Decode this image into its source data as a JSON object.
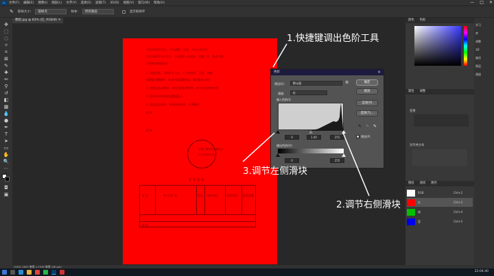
{
  "menubar": {
    "logo": "Ps",
    "items": [
      "文件(F)",
      "编辑(E)",
      "图像(I)",
      "图层(L)",
      "文字(Y)",
      "选择(S)",
      "滤镜(T)",
      "3D(D)",
      "视图(V)",
      "窗口(W)",
      "帮助(H)"
    ],
    "win_controls": [
      "—",
      "□",
      "✕"
    ]
  },
  "options": {
    "sample_label": "取样大小:",
    "sample_value": "取样点",
    "sample2_label": "样本:",
    "sample2_value": "所有图层",
    "ring_label": "显示取样环"
  },
  "document_tab": "教程.jpg @ 83% (红, RGB/8) ✕",
  "document": {
    "lines": [
      "2021年8月18日，六年级第一次会，于长沙市召开",
      "2021年8月18-20日，六年级第一次会议，会期三天，到会代表",
      "总会推选常委会议",
      "1. 知道主委，1988 年入党，入工作时间：已竞、结婚",
      "如果要设置颜色，有关内容请看附录，基本联系文档",
      "2. 在报告会议期间，讲话内容参考附件，作为主要参考内容",
      "3. 报告时间的各项议题报告人",
      "4. 报告会议安排，具体时间安排，注意事项",
      "附 件：",
      "附    件："
    ],
    "stamp_text": "中国工程院学术委员会",
    "stamp_text2": "2021年8月18日",
    "table_title": "参 会 回 执",
    "table_headers": [
      "姓 名",
      "单 位 职 务",
      "性别",
      "联系电话",
      "是否住宿",
      "是否用餐"
    ],
    "table_row2": "备 注"
  },
  "levels_dialog": {
    "title": "色阶",
    "preset_label": "预设(E):",
    "preset_value": "默认值",
    "channel_label": "通道:",
    "channel_value": "红",
    "input_label": "输入色阶(I):",
    "input_values": [
      "0",
      "1.00",
      "255"
    ],
    "output_label": "输出色阶(O):",
    "output_values": [
      "0",
      "255"
    ],
    "buttons": [
      "确定",
      "取消",
      "自动(A)",
      "选项(T)..."
    ],
    "preview_label": "预览(P)"
  },
  "annotations": {
    "step1": "1.快捷键调出色阶工具",
    "step2": "2.调节右侧滑块",
    "step3": "3.调节左侧滑块"
  },
  "panels": {
    "color_tabs": [
      "颜色",
      "色板"
    ],
    "props_tabs": [
      "属性",
      "调整"
    ],
    "props_item": "变换",
    "align_label": "对齐并分布",
    "layers_tabs": [
      "图层",
      "通道",
      "路径"
    ],
    "channels": [
      {
        "name": "RGB",
        "shortcut": "Ctrl+2",
        "color": "#ffffff"
      },
      {
        "name": "红",
        "shortcut": "Ctrl+3",
        "color": "#ff0000"
      },
      {
        "name": "绿",
        "shortcut": "Ctrl+4",
        "color": "#00c000"
      },
      {
        "name": "蓝",
        "shortcut": "Ctrl+5",
        "color": "#0000ee"
      }
    ],
    "right_labels": [
      "学习",
      "库",
      "调整",
      "3D",
      "路径",
      "图层",
      "通道"
    ]
  },
  "status": "100%   1653 像素 x 2339 像素 (96 ppi)",
  "taskbar": {
    "time": "22:04:40"
  }
}
